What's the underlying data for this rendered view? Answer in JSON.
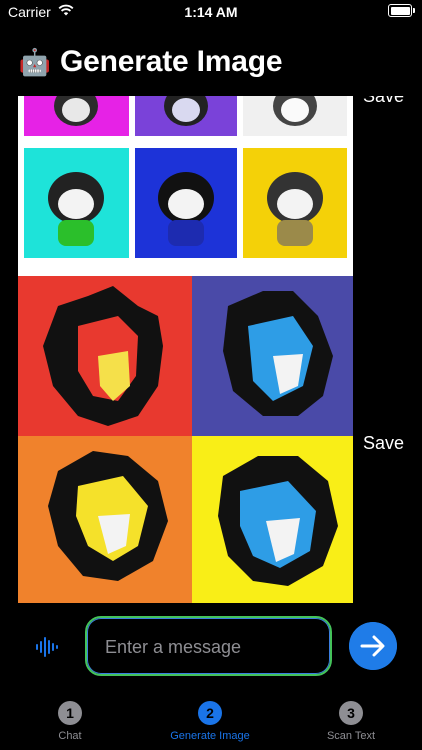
{
  "status_bar": {
    "carrier": "Carrier",
    "time": "1:14 AM"
  },
  "header": {
    "icon": "robot-icon",
    "title": "Generate Image"
  },
  "images": [
    {
      "subject": "bear",
      "save_label": "Save"
    },
    {
      "subject": "lion",
      "save_label": "Save"
    }
  ],
  "composer": {
    "placeholder": "Enter a message",
    "value": ""
  },
  "tabs": [
    {
      "number": "1",
      "label": "Chat",
      "active": false
    },
    {
      "number": "2",
      "label": "Generate Image",
      "active": true
    },
    {
      "number": "3",
      "label": "Scan Text",
      "active": false
    }
  ],
  "colors": {
    "accent": "#1A74E8",
    "send": "#1F7CE8",
    "field_border": "#44C25A"
  }
}
